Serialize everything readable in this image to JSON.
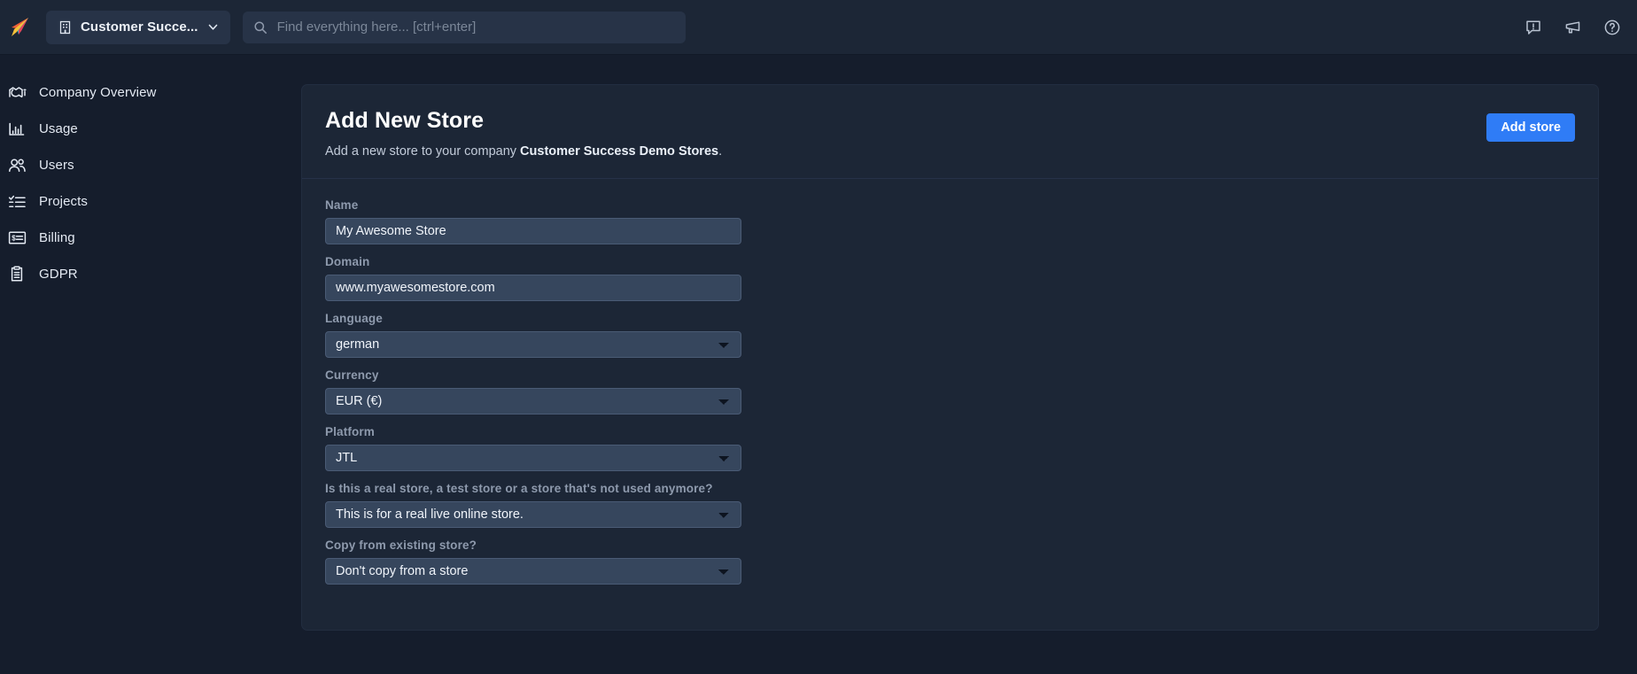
{
  "topbar": {
    "logo_icon": "paper-plane-logo",
    "company_selector": {
      "icon": "building-icon",
      "label": "Customer Succe...",
      "chevron": "chevron-down-icon"
    },
    "search": {
      "icon": "search-icon",
      "value": "",
      "placeholder": "Find everything here... [ctrl+enter]"
    },
    "actions": [
      {
        "icon": "feedback-bubble-icon"
      },
      {
        "icon": "megaphone-icon"
      },
      {
        "icon": "help-circle-icon"
      }
    ]
  },
  "sidebar": {
    "items": [
      {
        "icon": "company-overview-icon",
        "label": "Company Overview"
      },
      {
        "icon": "bar-chart-icon",
        "label": "Usage"
      },
      {
        "icon": "users-icon",
        "label": "Users"
      },
      {
        "icon": "checklist-icon",
        "label": "Projects"
      },
      {
        "icon": "billing-card-icon",
        "label": "Billing"
      },
      {
        "icon": "clipboard-icon",
        "label": "GDPR"
      }
    ]
  },
  "main": {
    "title": "Add New Store",
    "subtitle_prefix": "Add a new store to your company ",
    "subtitle_company": "Customer Success Demo Stores",
    "subtitle_suffix": ".",
    "add_store_button": "Add store",
    "form": {
      "name": {
        "label": "Name",
        "value": "My Awesome Store",
        "placeholder": ""
      },
      "domain": {
        "label": "Domain",
        "value": "www.myawesomestore.com",
        "placeholder": ""
      },
      "language": {
        "label": "Language",
        "value": "german"
      },
      "currency": {
        "label": "Currency",
        "value": "EUR (€)"
      },
      "platform": {
        "label": "Platform",
        "value": "JTL"
      },
      "store_type": {
        "label": "Is this a real store, a test store or a store that's not used anymore?",
        "value": "This is for a real live online store."
      },
      "copy_from": {
        "label": "Copy from existing store?",
        "value": "Don't copy from a store"
      }
    }
  },
  "colors": {
    "page_bg": "#151d2c",
    "panel_bg": "#1c2636",
    "accent": "#2f7cf6",
    "input_bg": "#36465d",
    "label": "#8e9aad"
  }
}
